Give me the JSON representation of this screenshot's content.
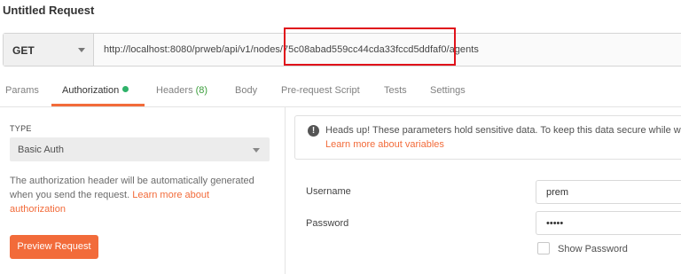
{
  "title": "Untitled Request",
  "request": {
    "method": "GET",
    "url": "http://localhost:8080/prweb/api/v1/nodes/75c08abad559cc44cda33fccd5ddfaf0/agents"
  },
  "tabs": [
    {
      "label": "Params"
    },
    {
      "label": "Authorization"
    },
    {
      "label": "Headers",
      "count": "(8)"
    },
    {
      "label": "Body"
    },
    {
      "label": "Pre-request Script"
    },
    {
      "label": "Tests"
    },
    {
      "label": "Settings"
    }
  ],
  "auth": {
    "type_label": "TYPE",
    "type_value": "Basic Auth",
    "description": "The authorization header will be automatically generated when you send the request. ",
    "learn_more": "Learn more about authorization",
    "preview_button": "Preview Request"
  },
  "notice": {
    "text": "Heads up! These parameters hold sensitive data. To keep this data secure while w",
    "link": "Learn more about variables"
  },
  "fields": {
    "username_label": "Username",
    "username_value": "prem",
    "password_label": "Password",
    "password_value": "•••••",
    "show_password_label": "Show Password"
  },
  "colors": {
    "accent": "#f26b3a",
    "highlight_box": "#e0121b",
    "auth_dot": "#2fb26a",
    "headers_count": "#3c9e3c"
  },
  "icons": {
    "method_dropdown": "chevron-down-icon",
    "auth_type_dropdown": "chevron-down-icon",
    "notice": "info-icon"
  }
}
